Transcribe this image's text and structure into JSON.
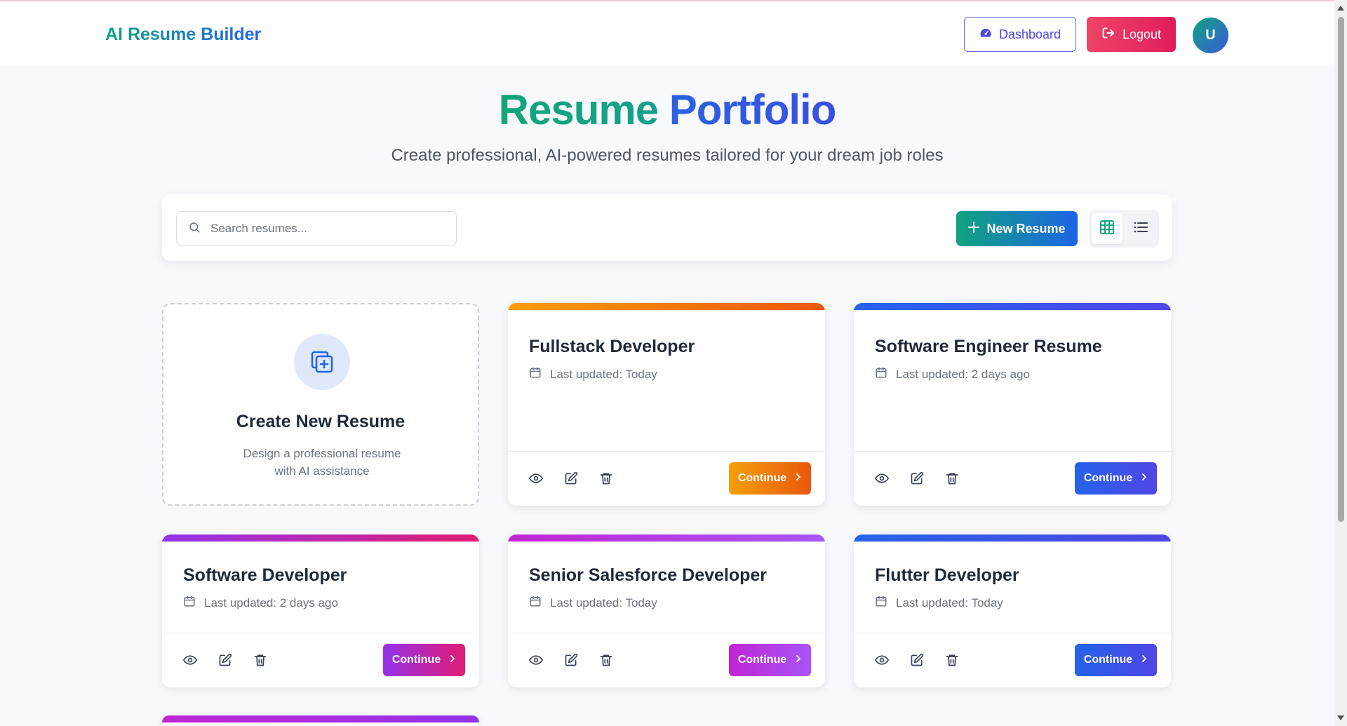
{
  "header": {
    "brand": "AI Resume Builder",
    "dashboard_label": "Dashboard",
    "logout_label": "Logout",
    "avatar_initial": "U"
  },
  "hero": {
    "title_part1": "Resume",
    "title_part2": "Portfolio",
    "subtitle": "Create professional, AI-powered resumes tailored for your dream job roles"
  },
  "toolbar": {
    "search_placeholder": "Search resumes...",
    "new_resume_label": "New Resume",
    "view_modes": [
      "grid",
      "list"
    ],
    "active_view": "grid"
  },
  "create_card": {
    "title": "Create New Resume",
    "description": "Design a professional resume with AI assistance"
  },
  "resumes": [
    {
      "title": "Fullstack Developer",
      "updated": "Last updated: Today",
      "continue_label": "Continue",
      "accent_from": "#f59e0b",
      "accent_to": "#ea580c"
    },
    {
      "title": "Software Engineer Resume",
      "updated": "Last updated: 2 days ago",
      "continue_label": "Continue",
      "accent_from": "#2563eb",
      "accent_to": "#4f46e5"
    },
    {
      "title": "Software Developer",
      "updated": "Last updated: 2 days ago",
      "continue_label": "Continue",
      "accent_from": "#9333ea",
      "accent_to": "#e11d74"
    },
    {
      "title": "Senior Salesforce Developer",
      "updated": "Last updated: Today",
      "continue_label": "Continue",
      "accent_from": "#c026d3",
      "accent_to": "#a855f7"
    },
    {
      "title": "Flutter Developer",
      "updated": "Last updated: Today",
      "continue_label": "Continue",
      "accent_from": "#2563eb",
      "accent_to": "#4f46e5"
    }
  ],
  "colors": {
    "brand_green": "#10a37f",
    "brand_blue": "#2563eb",
    "logout_red": "#e11d5b"
  }
}
